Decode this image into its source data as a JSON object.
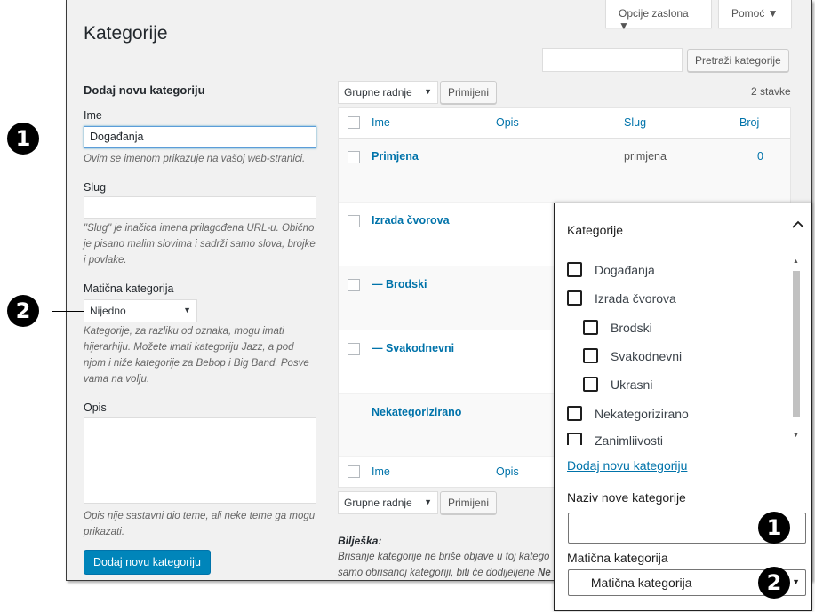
{
  "header": {
    "title": "Kategorije",
    "screen_options": "Opcije zaslona ▼",
    "help": "Pomoć ▼",
    "search_button": "Pretraži kategorije"
  },
  "form": {
    "heading": "Dodaj novu kategoriju",
    "name_label": "Ime",
    "name_value": "Događanja",
    "name_desc": "Ovim se imenom prikazuje na vašoj web-stranici.",
    "slug_label": "Slug",
    "slug_desc_1": "\"Slug\" je inačica imena prilagođena URL-u. Obično",
    "slug_desc_2": "je pisano malim slovima i sadrži samo slova, brojke",
    "slug_desc_3": "i povlake.",
    "parent_label": "Matična kategorija",
    "parent_value": "Nijedno",
    "parent_desc_1": "Kategorije, za razliku od oznaka, mogu imati",
    "parent_desc_2": "hijerarhiju. Možete imati kategoriju Jazz, a pod",
    "parent_desc_3": "njom i niže kategorije za Bebop i Big Band. Posve",
    "parent_desc_4": "vama na volju.",
    "desc_label": "Opis",
    "desc_desc_1": "Opis nije sastavni dio teme, ali neke teme ga mogu",
    "desc_desc_2": "prikazati.",
    "submit": "Dodaj novu kategoriju"
  },
  "list": {
    "bulk_actions": "Grupne radnje",
    "apply": "Primijeni",
    "count": "2 stavke",
    "columns": {
      "name": "Ime",
      "desc": "Opis",
      "slug": "Slug",
      "count": "Broj"
    },
    "rows": [
      {
        "name": "Primjena",
        "slug": "primjena",
        "count": "0"
      },
      {
        "name": "Izrada čvorova"
      },
      {
        "name": "— Brodski"
      },
      {
        "name": "— Svakodnevni"
      },
      {
        "name": "Nekategorizirano"
      }
    ],
    "note_title": "Bilješka:",
    "note_1": "Brisanje kategorije ne briše objave u toj katego",
    "note_2_start": "samo obrisanoj kategoriji, biti će dodijeljene ",
    "note_2_bold": "Ne"
  },
  "panel": {
    "title": "Kategorije",
    "items": [
      {
        "label": "Događanja"
      },
      {
        "label": "Izrada čvorova"
      },
      {
        "label": "Brodski"
      },
      {
        "label": "Svakodnevni"
      },
      {
        "label": "Ukrasni"
      },
      {
        "label": "Nekategorizirano"
      },
      {
        "label": "Zanimljivosti"
      }
    ],
    "add_link": "Dodaj novu kategoriju",
    "new_name_label": "Naziv nove kategorije",
    "parent_label": "Matična kategorija",
    "parent_value": "— Matična kategorija —"
  },
  "markers": {
    "one": "1",
    "two": "2"
  }
}
